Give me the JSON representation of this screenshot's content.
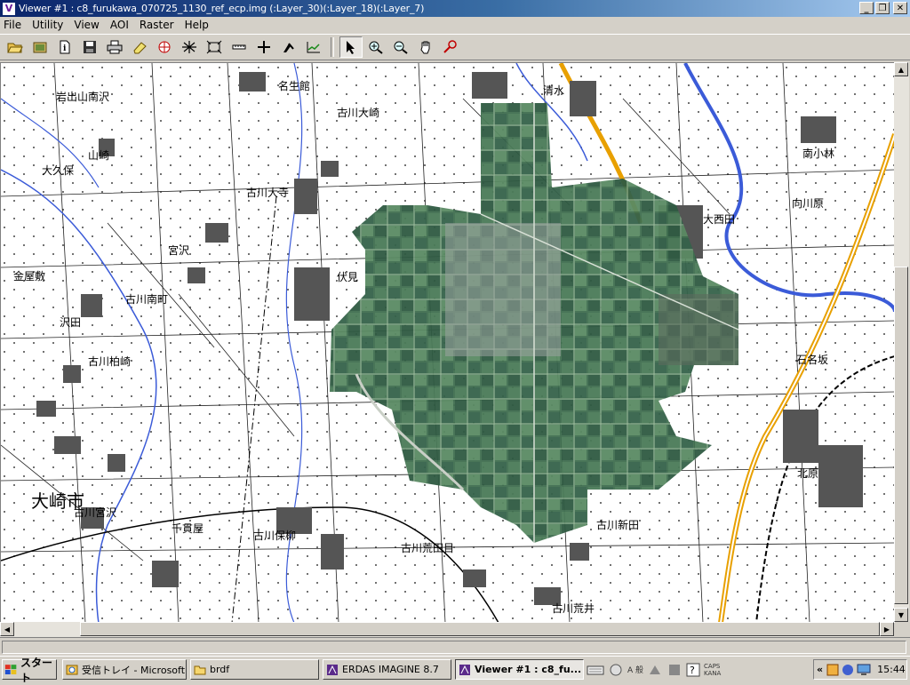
{
  "window": {
    "title": "Viewer #1 : c8_furukawa_070725_1130_ref_ecp.img (:Layer_30)(:Layer_18)(:Layer_7)",
    "minimize_glyph": "_",
    "maximize_glyph": "❐",
    "close_glyph": "✕"
  },
  "menu": [
    "File",
    "Utility",
    "View",
    "AOI",
    "Raster",
    "Help"
  ],
  "toolbar": {
    "tools": [
      {
        "name": "open-icon"
      },
      {
        "name": "open-layer-icon"
      },
      {
        "name": "info-icon"
      },
      {
        "name": "save-icon"
      },
      {
        "name": "print-icon"
      },
      {
        "name": "clear-icon"
      },
      {
        "name": "globe-icon"
      },
      {
        "name": "geolink-icon"
      },
      {
        "name": "fit-frame-icon"
      },
      {
        "name": "measure-icon"
      },
      {
        "name": "crosshair-icon"
      },
      {
        "name": "annotation-icon"
      },
      {
        "name": "profile-icon"
      }
    ],
    "nav_tools": [
      {
        "name": "select-arrow-icon",
        "pressed": true
      },
      {
        "name": "zoom-in-icon"
      },
      {
        "name": "zoom-out-icon"
      },
      {
        "name": "pan-hand-icon"
      },
      {
        "name": "inquire-icon"
      }
    ]
  },
  "map": {
    "place_labels": [
      "岩出山南沢",
      "山崎",
      "大久保",
      "古川大崎",
      "名生館",
      "清水",
      "南小林",
      "向川原",
      "大西田",
      "古川大寺",
      "宮沢",
      "古川南町",
      "金屋敷",
      "沢田",
      "伏見",
      "石名坂",
      "古川柏崎",
      "北原",
      "大崎市",
      "古川宮沢",
      "千貫屋",
      "古川保柳",
      "古川荒田目",
      "古川新田",
      "古川荒井"
    ]
  },
  "taskbar": {
    "start_label": "スタート",
    "tasks": [
      {
        "label": "受信トレイ - Microsoft ...",
        "active": false
      },
      {
        "label": "brdf",
        "active": false
      },
      {
        "label": "ERDAS IMAGINE 8.7",
        "active": false
      },
      {
        "label": "Viewer #1 : c8_fu...",
        "active": true
      }
    ],
    "ime": {
      "mode": "A 般",
      "caps": "CAPS",
      "kana": "KANA"
    },
    "tray_chevron": "«",
    "clock": "15:44"
  },
  "colors": {
    "titlebar_start": "#0a246a",
    "titlebar_end": "#a6caf0",
    "chrome": "#d4d0c8",
    "map_water": "#3b5bd8",
    "map_road": "#e8a000",
    "imagery_green": "#3f6e4f"
  }
}
